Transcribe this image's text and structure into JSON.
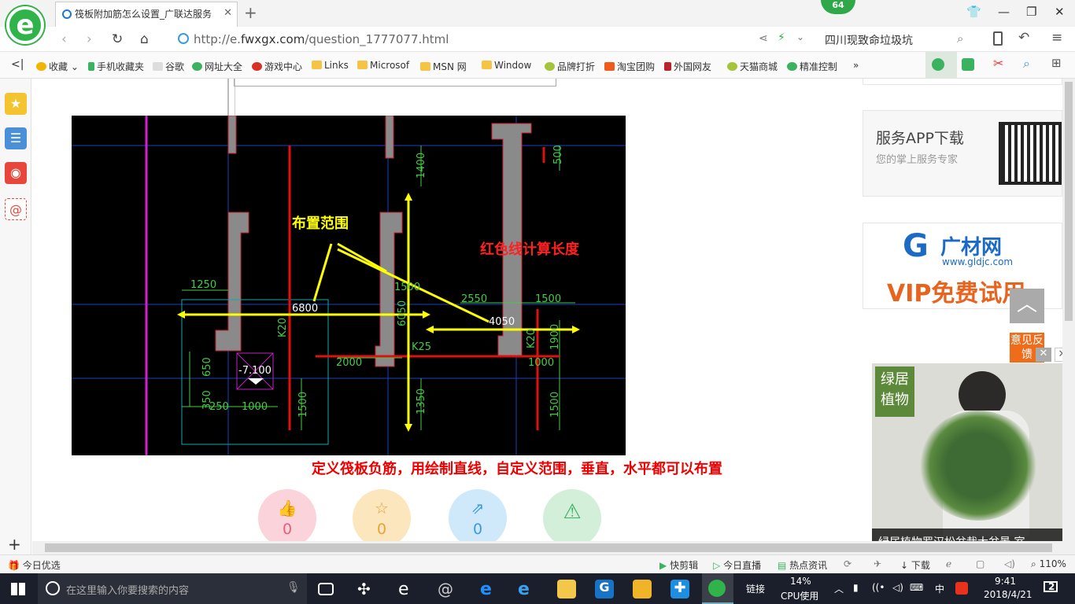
{
  "browser": {
    "tab_title": "筏板附加筋怎么设置_广联达服务",
    "tab_close": "✕",
    "new_tab": "+",
    "badge_count": "64",
    "url_prefix": "http://e.",
    "url_domain": "fwxgx.com",
    "url_path": "/question_1777077.html",
    "search_text": "四川现致命垃圾坑"
  },
  "bookmarks": [
    {
      "label": "收藏",
      "icon": "star-icon"
    },
    {
      "label": "手机收藏夹",
      "icon": "phone-icon"
    },
    {
      "label": "谷歌",
      "icon": "page-icon"
    },
    {
      "label": "网址大全",
      "icon": "globe-icon"
    },
    {
      "label": "游戏中心",
      "icon": "game-icon"
    },
    {
      "label": "Links",
      "icon": "folder-icon"
    },
    {
      "label": "Microsof",
      "icon": "folder-icon"
    },
    {
      "label": "MSN 网",
      "icon": "folder-icon"
    },
    {
      "label": "Window",
      "icon": "folder-icon"
    },
    {
      "label": "品牌打折",
      "icon": "leaf-icon"
    },
    {
      "label": "淘宝团购",
      "icon": "taobao-icon"
    },
    {
      "label": "外国网友",
      "icon": "flag-icon"
    },
    {
      "label": "天猫商城",
      "icon": "leaf-icon"
    },
    {
      "label": "精准控制",
      "icon": "chat-icon"
    }
  ],
  "bookmarks_more": "»",
  "cad": {
    "label_range": "布置范围",
    "label_red": "红色线计算长度",
    "dims": {
      "d1250": "1250",
      "d6800": "6800",
      "d6050": "6050",
      "d2550": "2550",
      "d1500a": "1500",
      "d4050": "4050",
      "d1400": "1400",
      "d500": "500",
      "d2000": "2000",
      "d1000a": "1000",
      "d650": "650",
      "d350": "350",
      "d250": "250",
      "d1000b": "1000",
      "d1500b": "1500",
      "d1350": "1350",
      "d1500c": "1500",
      "d1900": "1900",
      "d1000c": "1000",
      "k25": "K25",
      "k20a": "K20",
      "k20b": "K20",
      "elev": "-7.100",
      "d1500d": "1500"
    }
  },
  "caption": "定义筏板负筋，用绘制直线，自定义范围，垂直，水平都可以布置",
  "actions": [
    {
      "icon": "thumbs-up-icon",
      "count": "0",
      "color": "#f7c4cc",
      "fg": "#e6607a"
    },
    {
      "icon": "star-outline-icon",
      "count": "0",
      "color": "#fbe3b3",
      "fg": "#e7a43a"
    },
    {
      "icon": "share-icon",
      "count": "0",
      "color": "#c7e6fb",
      "fg": "#3c9be0"
    },
    {
      "icon": "warning-icon",
      "count": "",
      "color": "#cdeed6",
      "fg": "#3bb260"
    }
  ],
  "right": {
    "app_title": "服务APP下载",
    "app_sub": "您的掌上服务专家",
    "gc_brand": "广材网",
    "gc_url": "www.gldjc.com",
    "gc_vip": "VIP免费试用",
    "feedback": "意见反馈",
    "ad_brand_1": "绿居",
    "ad_brand_2": "植物",
    "ad_caption": "绿居植物罗汉松盆栽大盆景 室..."
  },
  "statusbar": {
    "left": "今日优选",
    "items": [
      "快剪辑",
      "今日直播",
      "热点资讯",
      "下载"
    ],
    "zoom": "110%"
  },
  "taskbar": {
    "search_placeholder": "在这里输入你要搜索的内容",
    "link": "链接",
    "cpu_pct": "14%",
    "cpu_label": "CPU使用",
    "ime": "中",
    "time": "9:41",
    "date": "2018/4/21",
    "notif": "2"
  }
}
